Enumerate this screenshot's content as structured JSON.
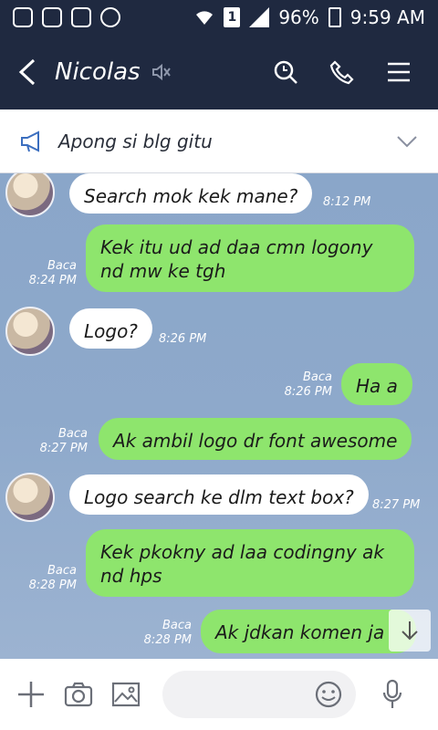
{
  "status_bar": {
    "battery": "96%",
    "time": "9:59 AM",
    "sim": "1"
  },
  "header": {
    "title": "Nicolas",
    "back_icon": "back-arrow-icon",
    "mute_icon": "muted-icon",
    "search_icon": "search-icon",
    "call_icon": "phone-icon",
    "menu_icon": "menu-icon"
  },
  "notice": {
    "text": "Apong si blg gitu"
  },
  "messages": [
    {
      "dir": "in",
      "text": "Search mok kek mane?",
      "time": "8:12 PM"
    },
    {
      "dir": "out",
      "text": "Kek itu ud ad daa cmn logony\nnd mw ke tgh",
      "read": "Baca",
      "time": "8:24 PM"
    },
    {
      "dir": "in",
      "text": "Logo?",
      "time": "8:26 PM"
    },
    {
      "dir": "out",
      "text": "Ha a",
      "read": "Baca",
      "time": "8:26 PM"
    },
    {
      "dir": "out",
      "text": "Ak ambil logo dr font awesome",
      "read": "Baca",
      "time": "8:27 PM"
    },
    {
      "dir": "in",
      "text": "Logo search ke dlm text box?",
      "time": "8:27 PM"
    },
    {
      "dir": "out",
      "text": "Kek pkokny ad laa codingny ak\nnd hps",
      "read": "Baca",
      "time": "8:28 PM"
    },
    {
      "dir": "out",
      "text": "Ak jdkan komen ja",
      "read": "Baca",
      "time": "8:28 PM"
    }
  ],
  "input": {
    "placeholder": ""
  },
  "colors": {
    "header_bg": "#1f2940",
    "bubble_out": "#8ee56d",
    "bubble_in": "#ffffff"
  }
}
